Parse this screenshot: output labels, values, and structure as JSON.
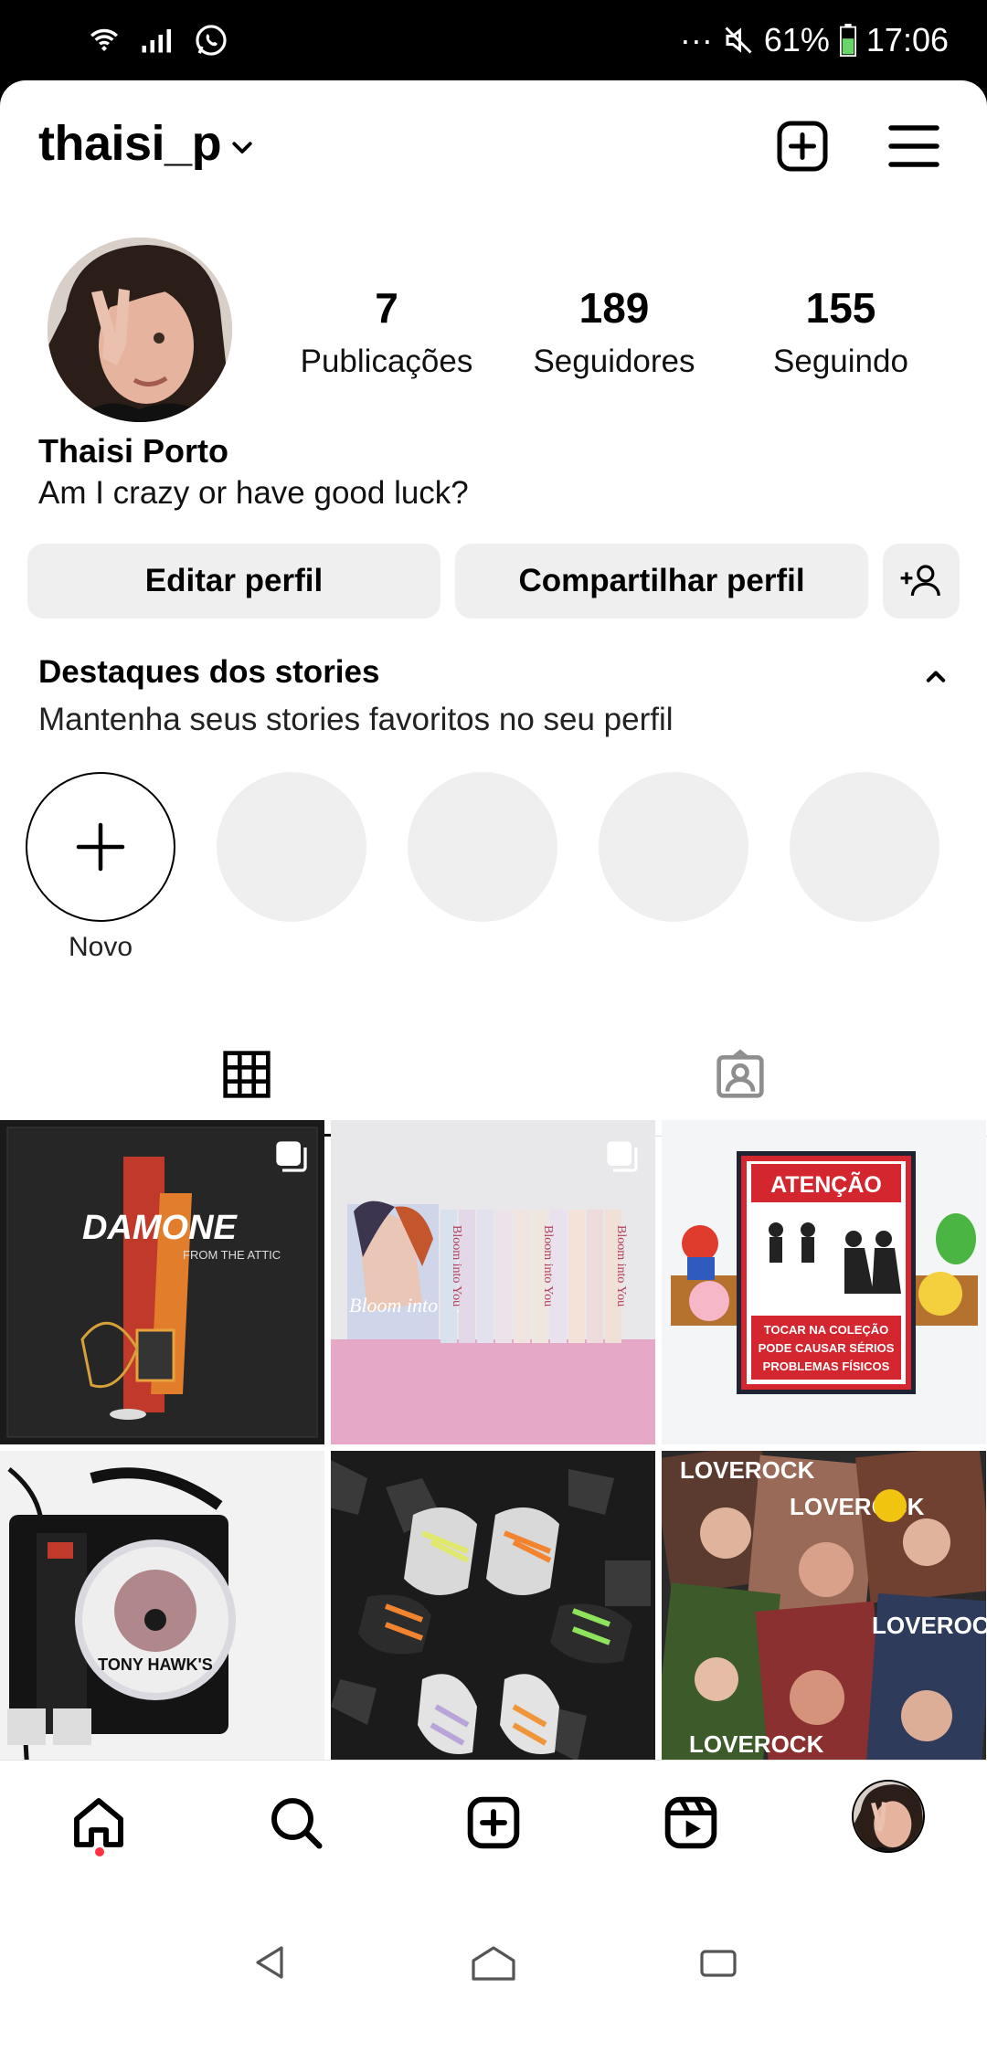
{
  "status_bar": {
    "dots": "···",
    "battery": "61%",
    "time": "17:06"
  },
  "header": {
    "username": "thaisi_p"
  },
  "profile": {
    "stats": [
      {
        "value": "7",
        "label": "Publicações"
      },
      {
        "value": "189",
        "label": "Seguidores"
      },
      {
        "value": "155",
        "label": "Seguindo"
      }
    ],
    "name": "Thaisi Porto",
    "bio": "Am I crazy or have good luck?"
  },
  "buttons": {
    "edit": "Editar perfil",
    "share": "Compartilhar perfil"
  },
  "highlights": {
    "title": "Destaques dos stories",
    "subtitle": "Mantenha seus stories favoritos no seu perfil",
    "new_label": "Novo"
  },
  "posts": {
    "p1": {
      "title": "DAMONE",
      "subtitle": "FROM THE ATTIC"
    },
    "p2": {
      "title": "Bloom into You",
      "spine": "Bloom into You"
    },
    "p3": {
      "sign_title": "ATENÇÃO",
      "sign_line1": "TOCAR NA COLEÇÃO",
      "sign_line2": "PODE CAUSAR SÉRIOS",
      "sign_line3": "PROBLEMAS FÍSICOS"
    },
    "p4": {
      "disc_text": "TONY HAWK'S"
    },
    "p6": {
      "brand": "LOVEROCK"
    }
  },
  "colors": {
    "accent_red": "#ff3040",
    "button_bg": "#efefef",
    "sign_red": "#d4262e"
  }
}
